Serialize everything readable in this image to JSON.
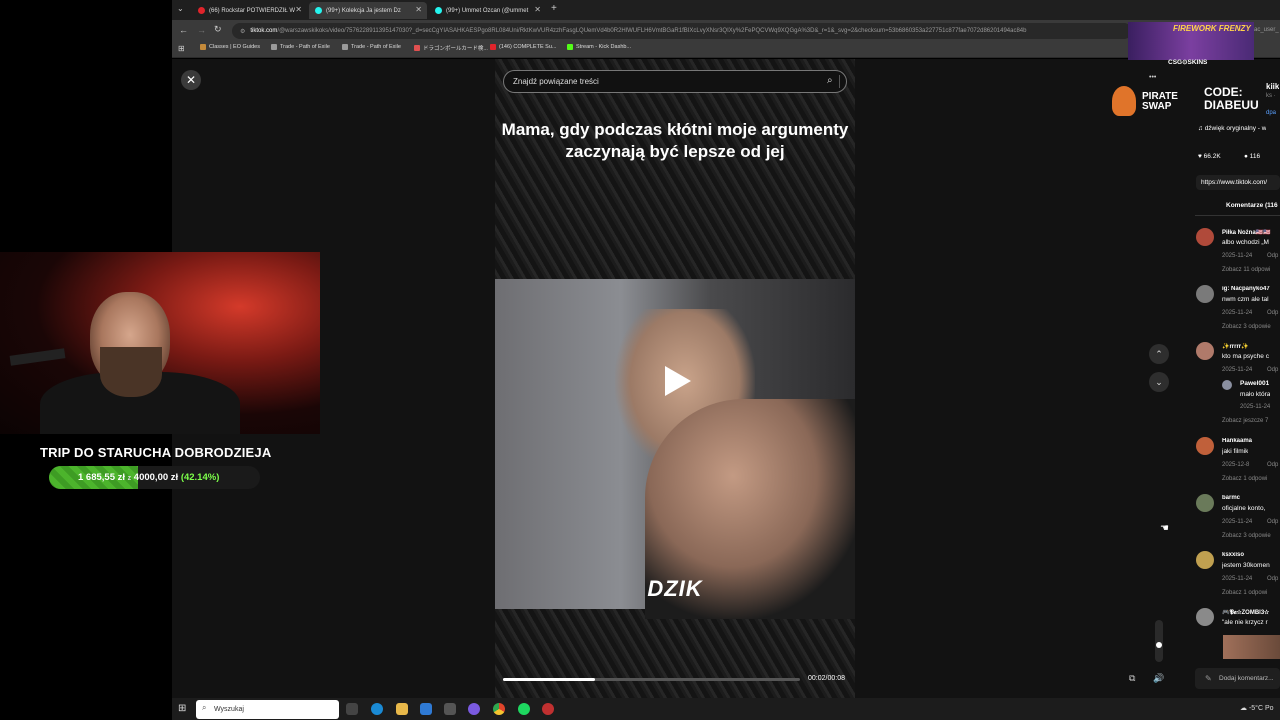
{
  "browser": {
    "tabs": [
      {
        "label": "(66) Rockstar POTWIERDZIŁ W",
        "fav_color": "#e0242b"
      },
      {
        "label": "(99+) Kolekcja Ja jestem Dz",
        "fav_color": "#25f4ee"
      },
      {
        "label": "(99+) Ummet Ozcan (@ummet",
        "fav_color": "#25f4ee"
      }
    ],
    "new_tab": "+",
    "url_host": "tiktok.com",
    "url_rest": "/@warszawskikoks/video/7576228911395147030?_d=secCgYIASAHKAESPgo8RL084Uni/RktKwVUR4zzhFasgLQUemVd4b0R2HlWUFLH6VmtBGaR1fBIXcLvyXNsr3QIXy%2FePQCVWq9XQGgA%3D&_r=1&_svg=2&checksum=53b6860353a227751c877fae7072d86201494ac84b",
    "url_tail": "ac_user_",
    "bookmarks": [
      {
        "label": "Classes | EO Guides",
        "color": "#c48a3a"
      },
      {
        "label": "Trade - Path of Exile",
        "color": "#9a9a9a"
      },
      {
        "label": "Trade - Path of Exile",
        "color": "#9a9a9a"
      },
      {
        "label": "ドラゴンボールカード検...",
        "color": "#e05050"
      },
      {
        "label": "(146) COMPLETE Su...",
        "color": "#e0242b"
      },
      {
        "label": "Stream - Kick Dashb...",
        "color": "#53fc18"
      }
    ]
  },
  "viewer": {
    "search_placeholder": "Znajdź powiązane treści",
    "caption": "Mama, gdy podczas kłótni moje argumenty zaczynają być lepsze od jej",
    "brand": "DZIK",
    "time": "00:02/00:08",
    "progress": 0.31,
    "close_symbol": "✕",
    "up_symbol": "⌃",
    "down_symbol": "⌄",
    "more_symbol": "•••"
  },
  "side": {
    "author_name": "kiik",
    "author_sub": "ks ·",
    "author_link": "dpa",
    "sound": "dźwięk oryginalny - w",
    "likes": "66.2K",
    "comments_count": "116",
    "link": "https://www.tiktok.com/",
    "comments_tab": "Komentarze (116",
    "comments": [
      {
        "user": "Piłka Nożna🇺🇸🇺🇸",
        "text": "albo wchodzi „M",
        "date": "2025-11-24",
        "reply": "Odp",
        "more": "Zobacz 11 odpowi",
        "color": "#b04a3a"
      },
      {
        "user": "ig: Nacpanyko47",
        "text": "nwm czm ale tal",
        "date": "2025-11-24",
        "reply": "Odp",
        "more": "Zobacz 3 odpowie",
        "color": "#7a7a7a"
      },
      {
        "user": "✨rrrrr✨",
        "text": "kto ma psyche c",
        "date": "2025-11-24",
        "reply": "Odp",
        "more": "",
        "color": "#b07a6a"
      },
      {
        "user": "Hankaama",
        "text": "jaki filmik",
        "date": "2025-12-8",
        "reply": "Odp",
        "more": "Zobacz 1 odpowi",
        "color": "#c0603a"
      },
      {
        "user": "barmc",
        "text": "oficjalne konto,",
        "date": "2025-11-24",
        "reply": "Odp",
        "more": "Zobacz 3 odpowie",
        "color": "#6a7a5a"
      },
      {
        "user": "ksxxiso",
        "text": "jestem 30komen",
        "date": "2025-11-24",
        "reply": "Odp",
        "more": "Zobacz 1 odpowi",
        "color": "#c0a050"
      },
      {
        "user": "🎮𝕻𝖆☆ZOMBI3☆",
        "text": "\"ale nie krzycz r",
        "date": "",
        "reply": "",
        "more": "",
        "color": "#8a8a8a"
      }
    ],
    "subreply": {
      "user": "Pawel001",
      "text": "mało która",
      "date": "2025-11-24",
      "more": "Zobacz jeszcze 7"
    },
    "add_comment": "Dodaj komentarz..."
  },
  "overlay": {
    "ad_top_title": "FIREWORK FRENZY",
    "ad_top_sub": "CSG⊙SKINS",
    "ad_pirate": "PIRATE SWAP",
    "ad_code": "CODE: DIABEUU",
    "donation_title": "TRIP DO STARUCHA DOBRODZIEJA",
    "donation_current": "1 685,55 zł",
    "donation_of": "z",
    "donation_goal": "4000,00 zł",
    "donation_percent": "(42.14%)",
    "donation_fraction": 0.4214
  },
  "taskbar": {
    "search_placeholder": "Wyszukaj",
    "weather": "-5°C",
    "weather_tail": "Po"
  }
}
